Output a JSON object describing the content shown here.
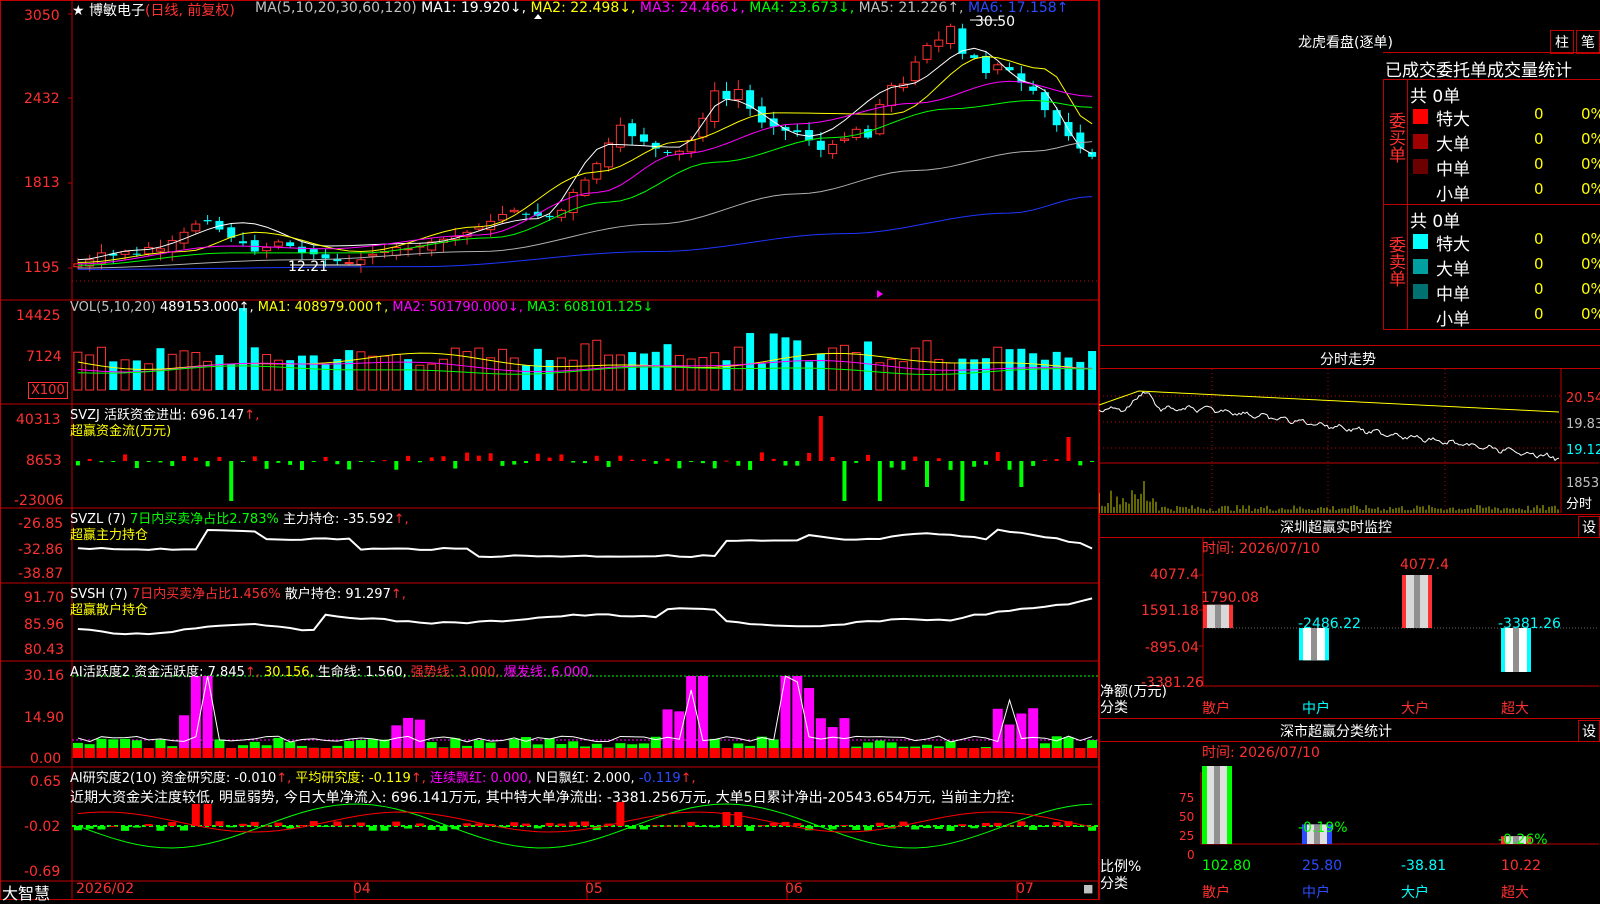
{
  "stock": {
    "title": "★ 博敏电子",
    "mode": "(日线, 前复权)",
    "ma_header": [
      {
        "t": "MA(5,10,20,30,60,120)",
        "c": "#c0c0c0"
      },
      {
        "t": " MA1: 19.920↓,",
        "c": "#ffffff"
      },
      {
        "t": " MA2: 22.498↓,",
        "c": "#ffff00"
      },
      {
        "t": " MA3: 24.466↓,",
        "c": "#ff00ff"
      },
      {
        "t": " MA4: 23.673↓,",
        "c": "#00ff00"
      },
      {
        "t": " MA5: 21.226↑,",
        "c": "#c0c0c0"
      },
      {
        "t": " MA6: 17.158↑",
        "c": "#2b4bff"
      }
    ],
    "price_axis": [
      "3050",
      "2432",
      "1813",
      "1195"
    ],
    "high_marker": "30.50",
    "low_marker": "12.21",
    "closes": [
      12.3,
      12.6,
      13.1,
      12.9,
      13.2,
      13.0,
      13.5,
      13.4,
      14.0,
      14.6,
      15.2,
      15.4,
      14.8,
      14.2,
      13.8,
      13.2,
      13.5,
      13.9,
      13.6,
      13.1,
      13.0,
      12.7,
      12.5,
      12.4,
      12.6,
      13.0,
      13.2,
      13.5,
      13.4,
      13.6,
      13.9,
      14.1,
      14.3,
      14.6,
      15.0,
      15.4,
      15.9,
      16.2,
      15.9,
      15.8,
      15.7,
      16.2,
      17.5,
      18.4,
      19.6,
      21.1,
      22.4,
      21.6,
      21.2,
      20.7,
      20.4,
      20.5,
      21.3,
      22.9,
      24.9,
      24.3,
      25.0,
      23.6,
      22.6,
      22.3,
      22.0,
      21.9,
      21.3,
      20.6,
      21.0,
      21.4,
      22.1,
      21.5,
      23.9,
      25.3,
      25.4,
      27.0,
      28.2,
      28.6,
      29.6,
      27.6,
      27.3,
      26.2,
      26.8,
      26.4,
      25.5,
      24.9,
      23.5,
      22.4,
      21.6,
      20.7,
      20.1
    ],
    "ma_series": [
      {
        "name": "MA5",
        "color": "#ffffff",
        "p": [
          1,
          12.6,
          6,
          13.3,
          15,
          15.3,
          22,
          13.6,
          30,
          13.8,
          40,
          15.6,
          46,
          21.0,
          52,
          20.8,
          56,
          24.3,
          63,
          21.6,
          71,
          25.3,
          77,
          28.0,
          82,
          25.4,
          87,
          20.3
        ]
      },
      {
        "name": "MA10",
        "color": "#ffff00",
        "p": [
          1,
          12.4,
          10,
          13.2,
          16,
          14.6,
          25,
          13.2,
          35,
          15.0,
          45,
          19.0,
          52,
          21.2,
          60,
          23.3,
          70,
          23.2,
          78,
          27.4,
          83,
          26.5,
          87,
          22.5
        ]
      },
      {
        "name": "MA20",
        "color": "#ff00ff",
        "p": [
          1,
          12.3,
          14,
          13.6,
          22,
          13.4,
          35,
          14.4,
          45,
          17.5,
          52,
          20.3,
          62,
          22.5,
          72,
          24.0,
          80,
          25.6,
          87,
          24.5
        ]
      },
      {
        "name": "MA30",
        "color": "#00ff00",
        "p": [
          1,
          12.2,
          14,
          13.1,
          25,
          13.1,
          36,
          14.2,
          46,
          16.8,
          55,
          19.7,
          65,
          21.5,
          75,
          23.6,
          82,
          24.2,
          87,
          23.7
        ]
      },
      {
        "name": "MA60",
        "color": "#b0b0b0",
        "p": [
          1,
          12.0,
          20,
          12.6,
          35,
          13.2,
          50,
          15.2,
          62,
          17.4,
          72,
          19.1,
          82,
          20.5,
          87,
          21.2
        ]
      },
      {
        "name": "MA120",
        "color": "#1f35ff",
        "p": [
          1,
          11.9,
          30,
          12.1,
          50,
          13.2,
          66,
          14.5,
          80,
          16.0,
          87,
          17.2
        ]
      }
    ]
  },
  "vol": {
    "header": [
      {
        "t": "VOL(5,10,20)",
        "c": "#c0c0c0"
      },
      {
        "t": " 489153.000↑,",
        "c": "#ffffff"
      },
      {
        "t": " MA1: 408979.000↑,",
        "c": "#ffff00"
      },
      {
        "t": " MA2: 501790.000↓,",
        "c": "#ff00ff"
      },
      {
        "t": " MA3: 608101.125↓",
        "c": "#00ff00"
      }
    ],
    "axis": [
      "14425",
      "7124"
    ],
    "unit": "X100"
  },
  "svzj": {
    "line1": [
      {
        "t": "SVZJ  活跃资金进出: 696.147",
        "c": "#ffffff"
      },
      {
        "t": "↑,",
        "c": "#ff3030"
      }
    ],
    "line2": [
      {
        "t": "超赢资金流(万元)",
        "c": "#ffff00"
      }
    ],
    "axis": [
      "40313",
      "8653",
      "-23006"
    ]
  },
  "svzl": {
    "line1": [
      {
        "t": "SVZL (7) ",
        "c": "#ffffff"
      },
      {
        "t": "7日内买卖净占比2.783%",
        "c": "#00ff00"
      },
      {
        "t": " 主力持仓: -35.592",
        "c": "#ffffff"
      },
      {
        "t": "↑,",
        "c": "#ff3030"
      }
    ],
    "line2": [
      {
        "t": "超赢主力持仓",
        "c": "#ffff00"
      }
    ],
    "axis": [
      "-26.85",
      "-32.86",
      "-38.87"
    ]
  },
  "svsh": {
    "line1": [
      {
        "t": "SVSH (7) ",
        "c": "#ffffff"
      },
      {
        "t": "7日内买卖净占比1.456%",
        "c": "#ff3030"
      },
      {
        "t": " 散户持仓: 91.297",
        "c": "#ffffff"
      },
      {
        "t": "↑,",
        "c": "#ff3030"
      }
    ],
    "line2": [
      {
        "t": "超赢散户持仓",
        "c": "#ffff00"
      }
    ],
    "axis": [
      "91.70",
      "85.96",
      "80.43"
    ]
  },
  "ai_active": {
    "line1": [
      {
        "t": "AI活跃度2 资金活跃度: 7.845",
        "c": "#ffffff"
      },
      {
        "t": "↑,",
        "c": "#ff3030"
      },
      {
        "t": " 30.156,",
        "c": "#ffff00"
      },
      {
        "t": " 生命线: 1.560,",
        "c": "#ffffff"
      },
      {
        "t": " 强势线: 3.000,",
        "c": "#ff3030"
      },
      {
        "t": " 爆发线: 6.000,",
        "c": "#ff00ff"
      }
    ],
    "axis": [
      "30.16",
      "14.90",
      "0.00"
    ]
  },
  "ai_research": {
    "line1": [
      {
        "t": "AI研究度2(10) 资金研究度: -0.010",
        "c": "#ffffff"
      },
      {
        "t": "↑,",
        "c": "#ff3030"
      },
      {
        "t": " 平均研究度: -0.119",
        "c": "#ffff00"
      },
      {
        "t": "↑,",
        "c": "#ff3030"
      },
      {
        "t": " 连续飘红: 0.000,",
        "c": "#ff00ff"
      },
      {
        "t": " N日飘红: 2.000,",
        "c": "#ffffff"
      },
      {
        "t": " -0.119",
        "c": "#2b4bff"
      },
      {
        "t": "↑,",
        "c": "#ff3030"
      }
    ],
    "comment": "近期大资金关注度较低, 明显弱势, 今日大单净流入: 696.141万元, 其中特大单净流出: -3381.256万元, 大单5日累计净出-20543.654万元, 当前主力控:",
    "axis": [
      "0.65",
      "-0.02",
      "-0.69"
    ]
  },
  "date_axis": [
    "2026/02",
    "04",
    "05",
    "06",
    "07"
  ],
  "brand": "大智慧",
  "dragon": {
    "title": "龙虎看盘(逐单)",
    "btn_bar": "柱",
    "btn_pen": "笔",
    "tabs": [
      "已成交",
      "委托单",
      "成交量统计"
    ],
    "buy_group": "委买单",
    "sell_group": "委卖单",
    "buy_total": "共 0单",
    "sell_total": "共 0单",
    "buy_rows": [
      {
        "label": "特大",
        "val": "0",
        "pct": "0%",
        "color": "#ff0000"
      },
      {
        "label": "大单",
        "val": "0",
        "pct": "0%",
        "color": "#a00000"
      },
      {
        "label": "中单",
        "val": "0",
        "pct": "0%",
        "color": "#6a0000"
      },
      {
        "label": "小单",
        "val": "0",
        "pct": "0%",
        "color": ""
      }
    ],
    "sell_rows": [
      {
        "label": "特大",
        "val": "0",
        "pct": "0%",
        "color": "#00ffff"
      },
      {
        "label": "大单",
        "val": "0",
        "pct": "0%",
        "color": "#00a0a0"
      },
      {
        "label": "中单",
        "val": "0",
        "pct": "0%",
        "color": "#007070"
      },
      {
        "label": "小单",
        "val": "0",
        "pct": "0%",
        "color": ""
      }
    ]
  },
  "intraday": {
    "title": "分时走势",
    "axis": [
      "20.54",
      "19.83",
      "19.12",
      "18531",
      "分时"
    ]
  },
  "sz_monitor": {
    "title": "深圳超赢实时监控",
    "settings": "设",
    "time_label": "时间: 2026/07/10",
    "axis": [
      "4077.4",
      "1591.18",
      "-895.04",
      "-3381.26"
    ],
    "axis_caption1": "净额(万元)",
    "axis_caption2": "分类",
    "categories": [
      "散户",
      "中户",
      "大户",
      "超大"
    ],
    "values": [
      1790.08,
      -2486.22,
      4077.4,
      -3381.26
    ],
    "labels": [
      "1790.08",
      "-2486.22",
      "4077.4",
      "-3381.26"
    ]
  },
  "sz_classify": {
    "title": "深市超赢分类统计",
    "settings": "设",
    "time_label": "时间: 2026/07/10",
    "axis": [
      "75",
      "50",
      "25",
      "0"
    ],
    "axis_caption1": "比例%",
    "axis_caption2": "分类",
    "categories": [
      "散户",
      "中户",
      "大户",
      "超大"
    ],
    "bottom_values": [
      "102.80",
      "25.80",
      "-38.81",
      "10.22"
    ],
    "top_labels": [
      "",
      "-0.19%",
      "",
      "-0.26%"
    ],
    "ratios": [
      102.8,
      25.8,
      0,
      10.22
    ]
  }
}
